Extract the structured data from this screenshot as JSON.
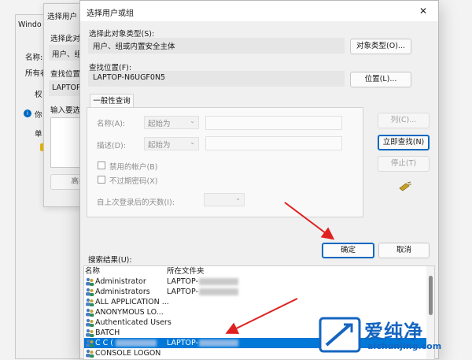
{
  "background": {
    "window1_title": "Windo",
    "window1_name_label": "名称:",
    "window1_owner_label": "所有者",
    "window1_tab": "权",
    "window1_info_text": "你",
    "window1_single": "单",
    "window2_title": "选择用户",
    "window2_type_label": "选择此对",
    "window2_type_value": "用户、组",
    "window2_loc_label": "查找位置",
    "window2_loc_value": "LAPTOP",
    "window2_input_label": "输入要选",
    "window2_adv_button": "高级"
  },
  "dialog": {
    "title": "选择用户或组",
    "object_type_label": "选择此对象类型(S):",
    "object_type_value": "用户、组或内置安全主体",
    "object_type_button": "对象类型(O)...",
    "location_label": "查找位置(F):",
    "location_value": "LAPTOP-N6UGF0N5",
    "location_button": "位置(L)...",
    "tab_label": "一般性查询",
    "name_label": "名称(A):",
    "name_mode": "起始为",
    "desc_label": "描述(D):",
    "desc_mode": "起始为",
    "disabled_accounts": "禁用的帐户(B)",
    "non_expiring_pw": "不过期密码(X)",
    "days_label": "自上次登录后的天数(I):",
    "columns_button": "列(C)...",
    "find_now_button": "立即查找(N)",
    "stop_button": "停止(T)",
    "ok_button": "确定",
    "cancel_button": "取消",
    "results_label": "搜索结果(U):",
    "results_headers": [
      "名称",
      "所在文件夹"
    ],
    "results": [
      {
        "name": "Administrator",
        "folder": "LAPTOP-"
      },
      {
        "name": "Administrators",
        "folder": "LAPTOP-"
      },
      {
        "name": "ALL APPLICATION ...",
        "folder": ""
      },
      {
        "name": "ANONYMOUS LO...",
        "folder": ""
      },
      {
        "name": "Authenticated Users",
        "folder": ""
      },
      {
        "name": "BATCH",
        "folder": ""
      },
      {
        "name": "C C (",
        "folder": "LAPTOP-"
      },
      {
        "name": "CONSOLE LOGON",
        "folder": ""
      }
    ],
    "selected_row": 6
  },
  "watermark": {
    "brand": "爱纯净",
    "url": "aichunjing.com"
  },
  "colors": {
    "accent": "#0078d7",
    "primary_border": "#0067c0",
    "arrow": "#e02020",
    "watermark": "#1565c0"
  }
}
